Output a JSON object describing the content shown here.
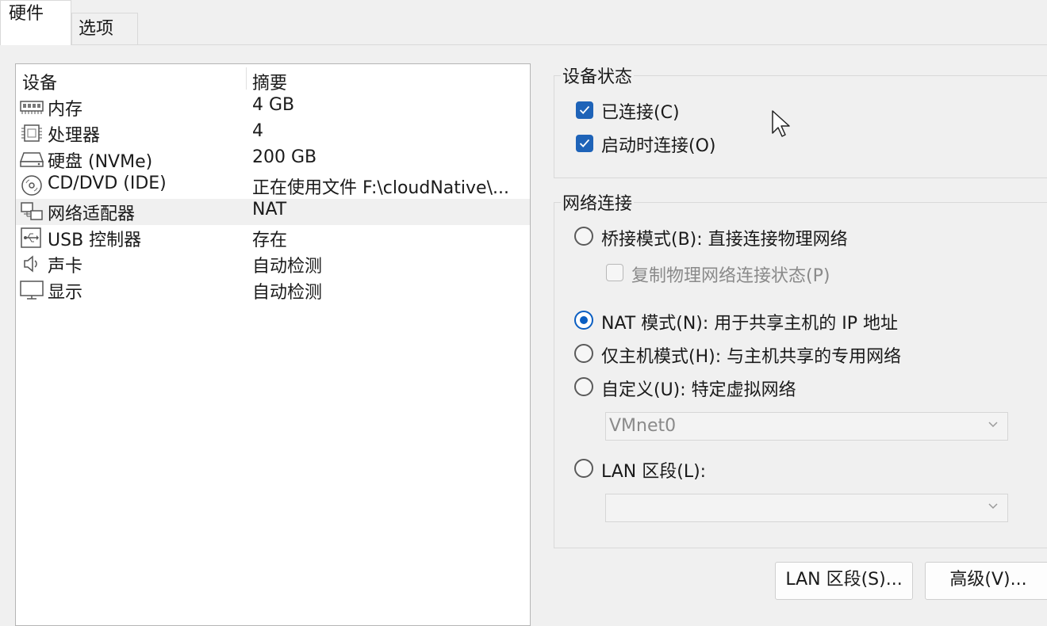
{
  "tabs": [
    {
      "label": "硬件",
      "active": true
    },
    {
      "label": "选项",
      "active": false
    }
  ],
  "device_list": {
    "columns": [
      "设备",
      "摘要"
    ],
    "rows": [
      {
        "icon": "memory-icon",
        "name": "内存",
        "summary": "4 GB"
      },
      {
        "icon": "processor-icon",
        "name": "处理器",
        "summary": "4"
      },
      {
        "icon": "hard-disk-icon",
        "name": "硬盘 (NVMe)",
        "summary": "200 GB"
      },
      {
        "icon": "cd-dvd-icon",
        "name": "CD/DVD (IDE)",
        "summary": "正在使用文件 F:\\cloudNative\\..."
      },
      {
        "icon": "network-adapter-icon",
        "name": "网络适配器",
        "summary": "NAT",
        "selected": true
      },
      {
        "icon": "usb-icon",
        "name": "USB 控制器",
        "summary": "存在"
      },
      {
        "icon": "sound-card-icon",
        "name": "声卡",
        "summary": "自动检测"
      },
      {
        "icon": "display-icon",
        "name": "显示",
        "summary": "自动检测"
      }
    ]
  },
  "device_status": {
    "title": "设备状态",
    "connected": {
      "label": "已连接(C)",
      "checked": true
    },
    "connect_at_power_on": {
      "label": "启动时连接(O)",
      "checked": true
    }
  },
  "network_connection": {
    "title": "网络连接",
    "bridged": {
      "label": "桥接模式(B): 直接连接物理网络",
      "selected": false
    },
    "replicate": {
      "label": "复制物理网络连接状态(P)",
      "checked": false,
      "disabled": true
    },
    "nat": {
      "label": "NAT 模式(N): 用于共享主机的 IP 地址",
      "selected": true
    },
    "host_only": {
      "label": "仅主机模式(H): 与主机共享的专用网络",
      "selected": false
    },
    "custom": {
      "label": "自定义(U): 特定虚拟网络",
      "selected": false
    },
    "custom_select": {
      "value": "VMnet0",
      "disabled": true
    },
    "lan_segment": {
      "label": "LAN 区段(L):",
      "selected": false
    },
    "lan_select": {
      "value": "",
      "disabled": true
    }
  },
  "buttons": {
    "lan_segments": "LAN 区段(S)...",
    "advanced": "高级(V)..."
  },
  "colors": {
    "accent": "#1e63b8",
    "radio_accent": "#0a5ec2",
    "disabled_text": "#8a8a8a"
  }
}
